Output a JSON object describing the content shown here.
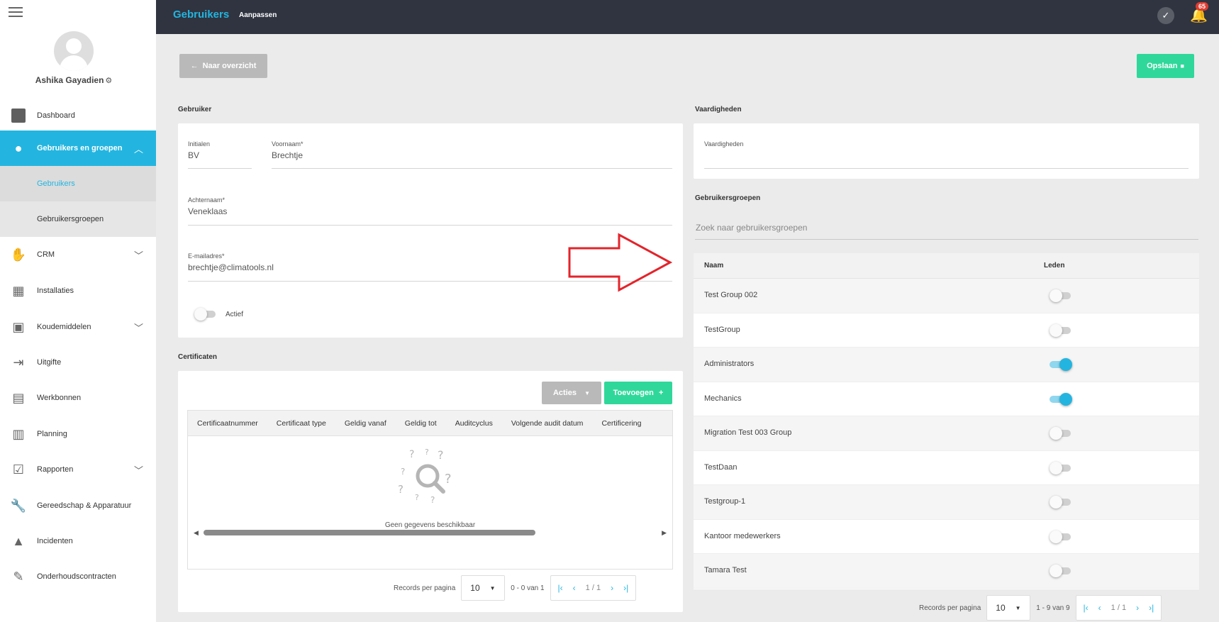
{
  "app": {
    "title": "Gebruikers",
    "crumb": "Aanpassen",
    "notifications": "65"
  },
  "user": {
    "name": "Ashika Gayadien"
  },
  "sidebar": {
    "items": [
      {
        "label": "Dashboard",
        "icon": "dashboard-icon"
      },
      {
        "label": "Gebruikers en groepen",
        "icon": "user-icon",
        "active": true
      },
      {
        "label": "CRM",
        "icon": "handshake-icon"
      },
      {
        "label": "Installaties",
        "icon": "installation-icon"
      },
      {
        "label": "Koudemiddelen",
        "icon": "cylinder-icon"
      },
      {
        "label": "Uitgifte",
        "icon": "exit-icon"
      },
      {
        "label": "Werkbonnen",
        "icon": "workorder-icon"
      },
      {
        "label": "Planning",
        "icon": "calendar-icon"
      },
      {
        "label": "Rapporten",
        "icon": "report-icon"
      },
      {
        "label": "Gereedschap & Apparatuur",
        "icon": "wrench-icon"
      },
      {
        "label": "Incidenten",
        "icon": "warning-icon"
      },
      {
        "label": "Onderhoudscontracten",
        "icon": "contract-icon"
      }
    ],
    "sub_items": [
      {
        "label": "Gebruikers",
        "current": true
      },
      {
        "label": "Gebruikersgroepen"
      }
    ]
  },
  "actions": {
    "back_label": "Naar overzicht",
    "save_label": "Opslaan"
  },
  "gebruiker": {
    "section_label": "Gebruiker",
    "initials_label": "Initialen",
    "initials_value": "BV",
    "firstname_label": "Voornaam*",
    "firstname_value": "Brechtje",
    "lastname_label": "Achternaam*",
    "lastname_value": "Veneklaas",
    "email_label": "E-mailadres*",
    "email_value": "brechtje@climatools.nl",
    "active_label": "Actief",
    "active": false
  },
  "certificaten": {
    "section_label": "Certificaten",
    "acties_label": "Acties",
    "toevoegen_label": "Toevoegen",
    "columns": [
      "Certificaatnummer",
      "Certificaat type",
      "Geldig vanaf",
      "Geldig tot",
      "Auditcyclus",
      "Volgende audit datum",
      "Certificering"
    ],
    "empty_text": "Geen gegevens beschikbaar",
    "pager": {
      "rpp_label": "Records per pagina",
      "rpp_value": "10",
      "range": "0 - 0 van 1",
      "page": "1 / 1"
    }
  },
  "vaardigheden": {
    "section_label": "Vaardigheden",
    "field_label": "Vaardigheden"
  },
  "gebruikersgroepen": {
    "section_label": "Gebruikersgroepen",
    "search_placeholder": "Zoek naar gebruikersgroepen",
    "col_name": "Naam",
    "col_members": "Leden",
    "rows": [
      {
        "name": "Test Group 002",
        "member": false
      },
      {
        "name": "TestGroup",
        "member": false
      },
      {
        "name": "Administrators",
        "member": true
      },
      {
        "name": "Mechanics",
        "member": true
      },
      {
        "name": "Migration Test 003 Group",
        "member": false
      },
      {
        "name": "TestDaan",
        "member": false
      },
      {
        "name": "Testgroup-1",
        "member": false
      },
      {
        "name": "Kantoor medewerkers",
        "member": false
      },
      {
        "name": "Tamara Test",
        "member": false
      }
    ],
    "pager": {
      "rpp_label": "Records per pagina",
      "rpp_value": "10",
      "range": "1 - 9 van 9",
      "page": "1 / 1"
    }
  },
  "colors": {
    "accent": "#23b5e0",
    "topbar": "#2f3440",
    "save": "#2fd89a",
    "annotation_arrow": "#e3242b"
  }
}
